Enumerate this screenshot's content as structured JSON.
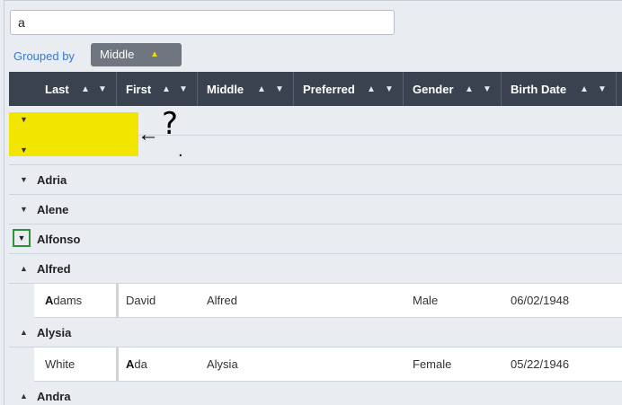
{
  "search": {
    "value": "a"
  },
  "grouping": {
    "label": "Grouped by",
    "chip_label": "Middle",
    "chip_indicator": "▲"
  },
  "columns": [
    {
      "label": "Last"
    },
    {
      "label": "First"
    },
    {
      "label": "Middle"
    },
    {
      "label": "Preferred"
    },
    {
      "label": "Gender"
    },
    {
      "label": "Birth Date"
    }
  ],
  "header_icons": {
    "sort": "▲",
    "filter": "▼"
  },
  "groups": {
    "empty1": {
      "caret": "▼",
      "label": ""
    },
    "empty2": {
      "caret": "▼",
      "label": ""
    },
    "adria": {
      "caret": "▼",
      "label": "Adria"
    },
    "alene": {
      "caret": "▼",
      "label": "Alene"
    },
    "alfonso": {
      "caret": "▼",
      "label": "Alfonso"
    },
    "alfred": {
      "caret": "▲",
      "label": "Alfred"
    },
    "alysia": {
      "caret": "▲",
      "label": "Alysia"
    },
    "andra": {
      "caret": "▲",
      "label": "Andra"
    }
  },
  "rows": {
    "adams": {
      "last_hl": "A",
      "last_rest": "dams",
      "first_hl": "",
      "first_rest": "David",
      "middle": "Alfred",
      "preferred": "",
      "gender": "Male",
      "birth": "06/02/1948"
    },
    "white": {
      "last_hl": "",
      "last_rest": "White",
      "first_hl": "A",
      "first_rest": "da",
      "middle": "Alysia",
      "preferred": "",
      "gender": "Female",
      "birth": "05/22/1946"
    }
  },
  "annotation": {
    "arrow": "←",
    "question": "?",
    "dot": "."
  },
  "colors": {
    "header_bg": "#3a4250",
    "accent": "#3a79c9",
    "chip_bg": "#6f7680",
    "highlight": "#f2e600",
    "focus": "#2f8f3a"
  }
}
